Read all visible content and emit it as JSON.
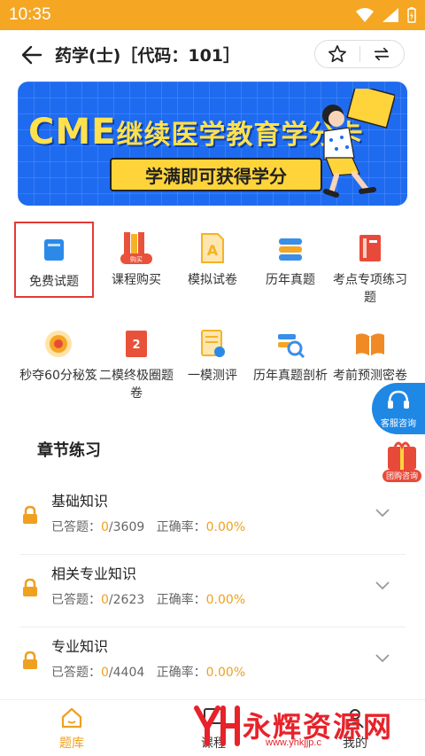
{
  "status_bar": {
    "time": "10:35"
  },
  "header": {
    "title": "药学(士)［代码：101］"
  },
  "banner": {
    "cme": "CME",
    "headline": "继续医学教育学分卡",
    "subline": "学满即可获得学分"
  },
  "categories": [
    {
      "label": "免费试题",
      "icon": "book-icon",
      "color": "#2b8ae8"
    },
    {
      "label": "课程购买",
      "icon": "books-purchase-icon",
      "color": "#e8523a"
    },
    {
      "label": "模拟试卷",
      "icon": "exam-paper-icon",
      "color": "#f5b324"
    },
    {
      "label": "历年真题",
      "icon": "layers-icon",
      "color": "#3a8ee8"
    },
    {
      "label": "考点专项练习题",
      "icon": "notebook-icon",
      "color": "#e84a3a"
    },
    {
      "label": "秒夺60分秘笈",
      "icon": "target-icon",
      "color": "#f5a623"
    },
    {
      "label": "二模终极圈题卷",
      "icon": "paper-2-icon",
      "color": "#e8523a"
    },
    {
      "label": "一模测评",
      "icon": "evaluation-icon",
      "color": "#f5b324"
    },
    {
      "label": "历年真题剖析",
      "icon": "magnify-analysis-icon",
      "color": "#3a8ee8"
    },
    {
      "label": "考前预测密卷",
      "icon": "open-book-icon",
      "color": "#f08a24"
    }
  ],
  "floating": {
    "service_label": "客服咨询",
    "group_label": "团购咨询"
  },
  "section": {
    "title": "章节练习"
  },
  "chapters": [
    {
      "name": "基础知识",
      "answered_label": "已答题：",
      "done": "0",
      "total": "/3609",
      "rate_label": "正确率：",
      "rate": "0.00%"
    },
    {
      "name": "相关专业知识",
      "answered_label": "已答题：",
      "done": "0",
      "total": "/2623",
      "rate_label": "正确率：",
      "rate": "0.00%"
    },
    {
      "name": "专业知识",
      "answered_label": "已答题：",
      "done": "0",
      "total": "/4404",
      "rate_label": "正确率：",
      "rate": "0.00%"
    }
  ],
  "bottom_nav": [
    {
      "label": "题库",
      "icon": "home-icon",
      "active": true
    },
    {
      "label": "课程",
      "icon": "course-icon",
      "active": false
    },
    {
      "label": "我的",
      "icon": "profile-icon",
      "active": false
    }
  ],
  "watermark": {
    "text": "永辉资源网",
    "url": "www.yhkjjp.c"
  },
  "colors": {
    "accent": "#f0a020",
    "status_bar": "#f5a623",
    "banner": "#1e6bf0",
    "selected_border": "#e53935"
  }
}
